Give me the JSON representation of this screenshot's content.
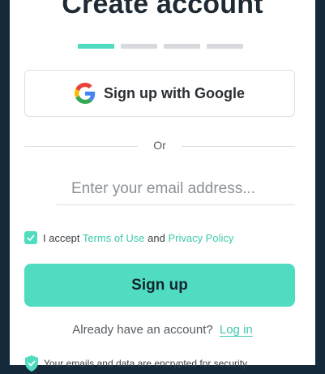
{
  "page": {
    "title": "Create account",
    "steps_total": 4,
    "steps_active": 1
  },
  "google_button": {
    "label": "Sign up with Google",
    "icon": "google-icon"
  },
  "divider": {
    "text": "Or"
  },
  "email": {
    "value": "",
    "placeholder": "Enter your email address..."
  },
  "terms": {
    "checked": true,
    "prefix": "I accept",
    "terms_link": "Terms of Use",
    "conjunction": "and",
    "privacy_link": "Privacy Policy"
  },
  "signup_button": {
    "label": "Sign up"
  },
  "login": {
    "prompt": "Already have an account?",
    "link": "Log in"
  },
  "security": {
    "text": "Your emails and data are encrypted for security",
    "icon": "shield-icon"
  },
  "colors": {
    "accent": "#4fdcc0",
    "link": "#3fc9ad",
    "background": "#14293a",
    "text_dark": "#1f2a33"
  }
}
